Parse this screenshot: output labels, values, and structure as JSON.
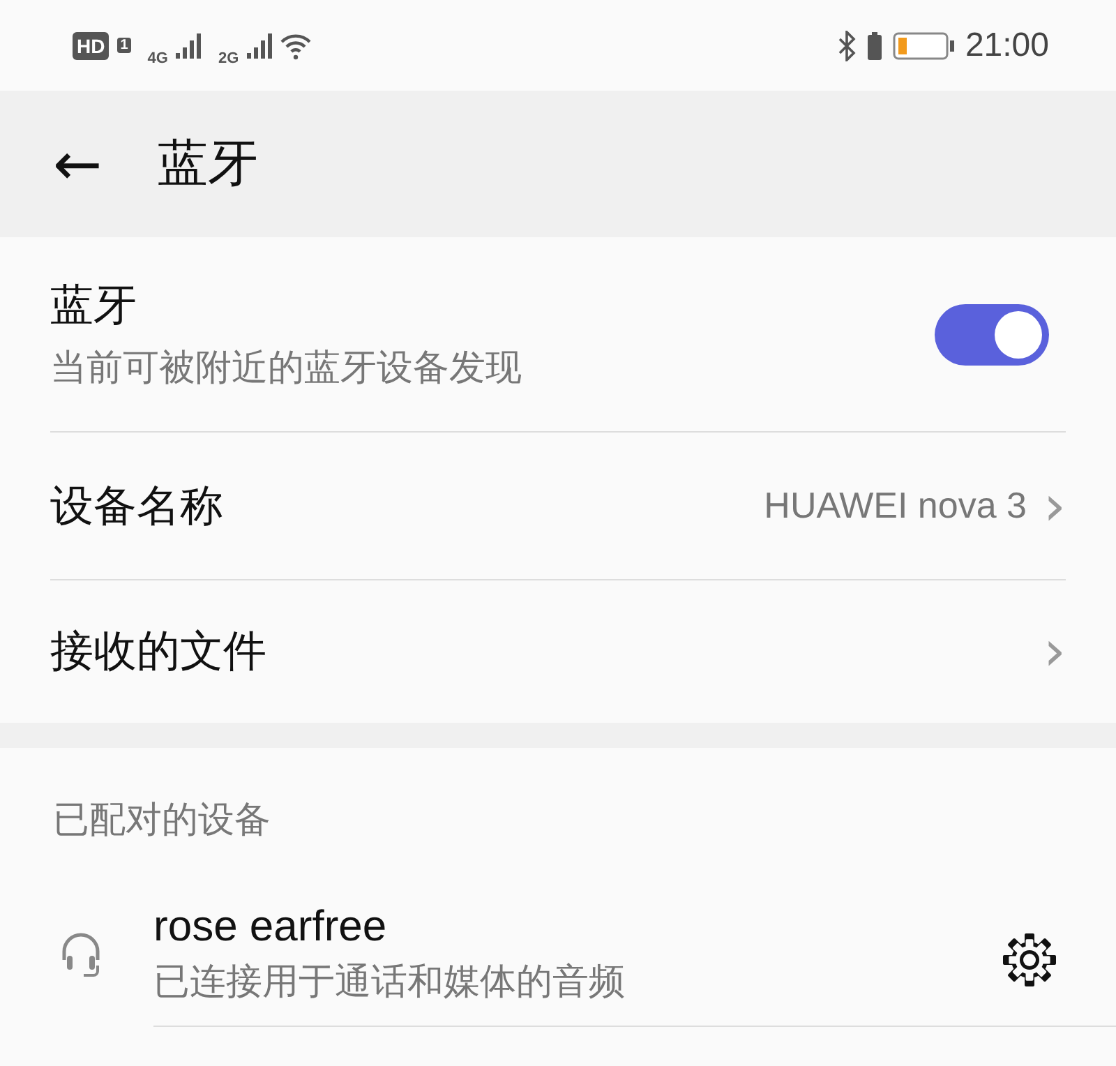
{
  "status_bar": {
    "hd": "HD",
    "sim": "1",
    "network_1": "4G",
    "network_2": "2G",
    "time": "21:00"
  },
  "header": {
    "back": "←",
    "title": "蓝牙"
  },
  "settings": [
    {
      "kind": "toggle",
      "title": "蓝牙",
      "subtitle": "当前可被附近的蓝牙设备发现",
      "on": true
    },
    {
      "kind": "link",
      "title": "设备名称",
      "value": "HUAWEI nova 3",
      "chevron": "›"
    },
    {
      "kind": "link",
      "title": "接收的文件",
      "chevron": "›"
    }
  ],
  "paired": {
    "heading": "已配对的设备",
    "devices": [
      {
        "name": "rose earfree",
        "status": "已连接用于通话和媒体的音频"
      }
    ]
  }
}
